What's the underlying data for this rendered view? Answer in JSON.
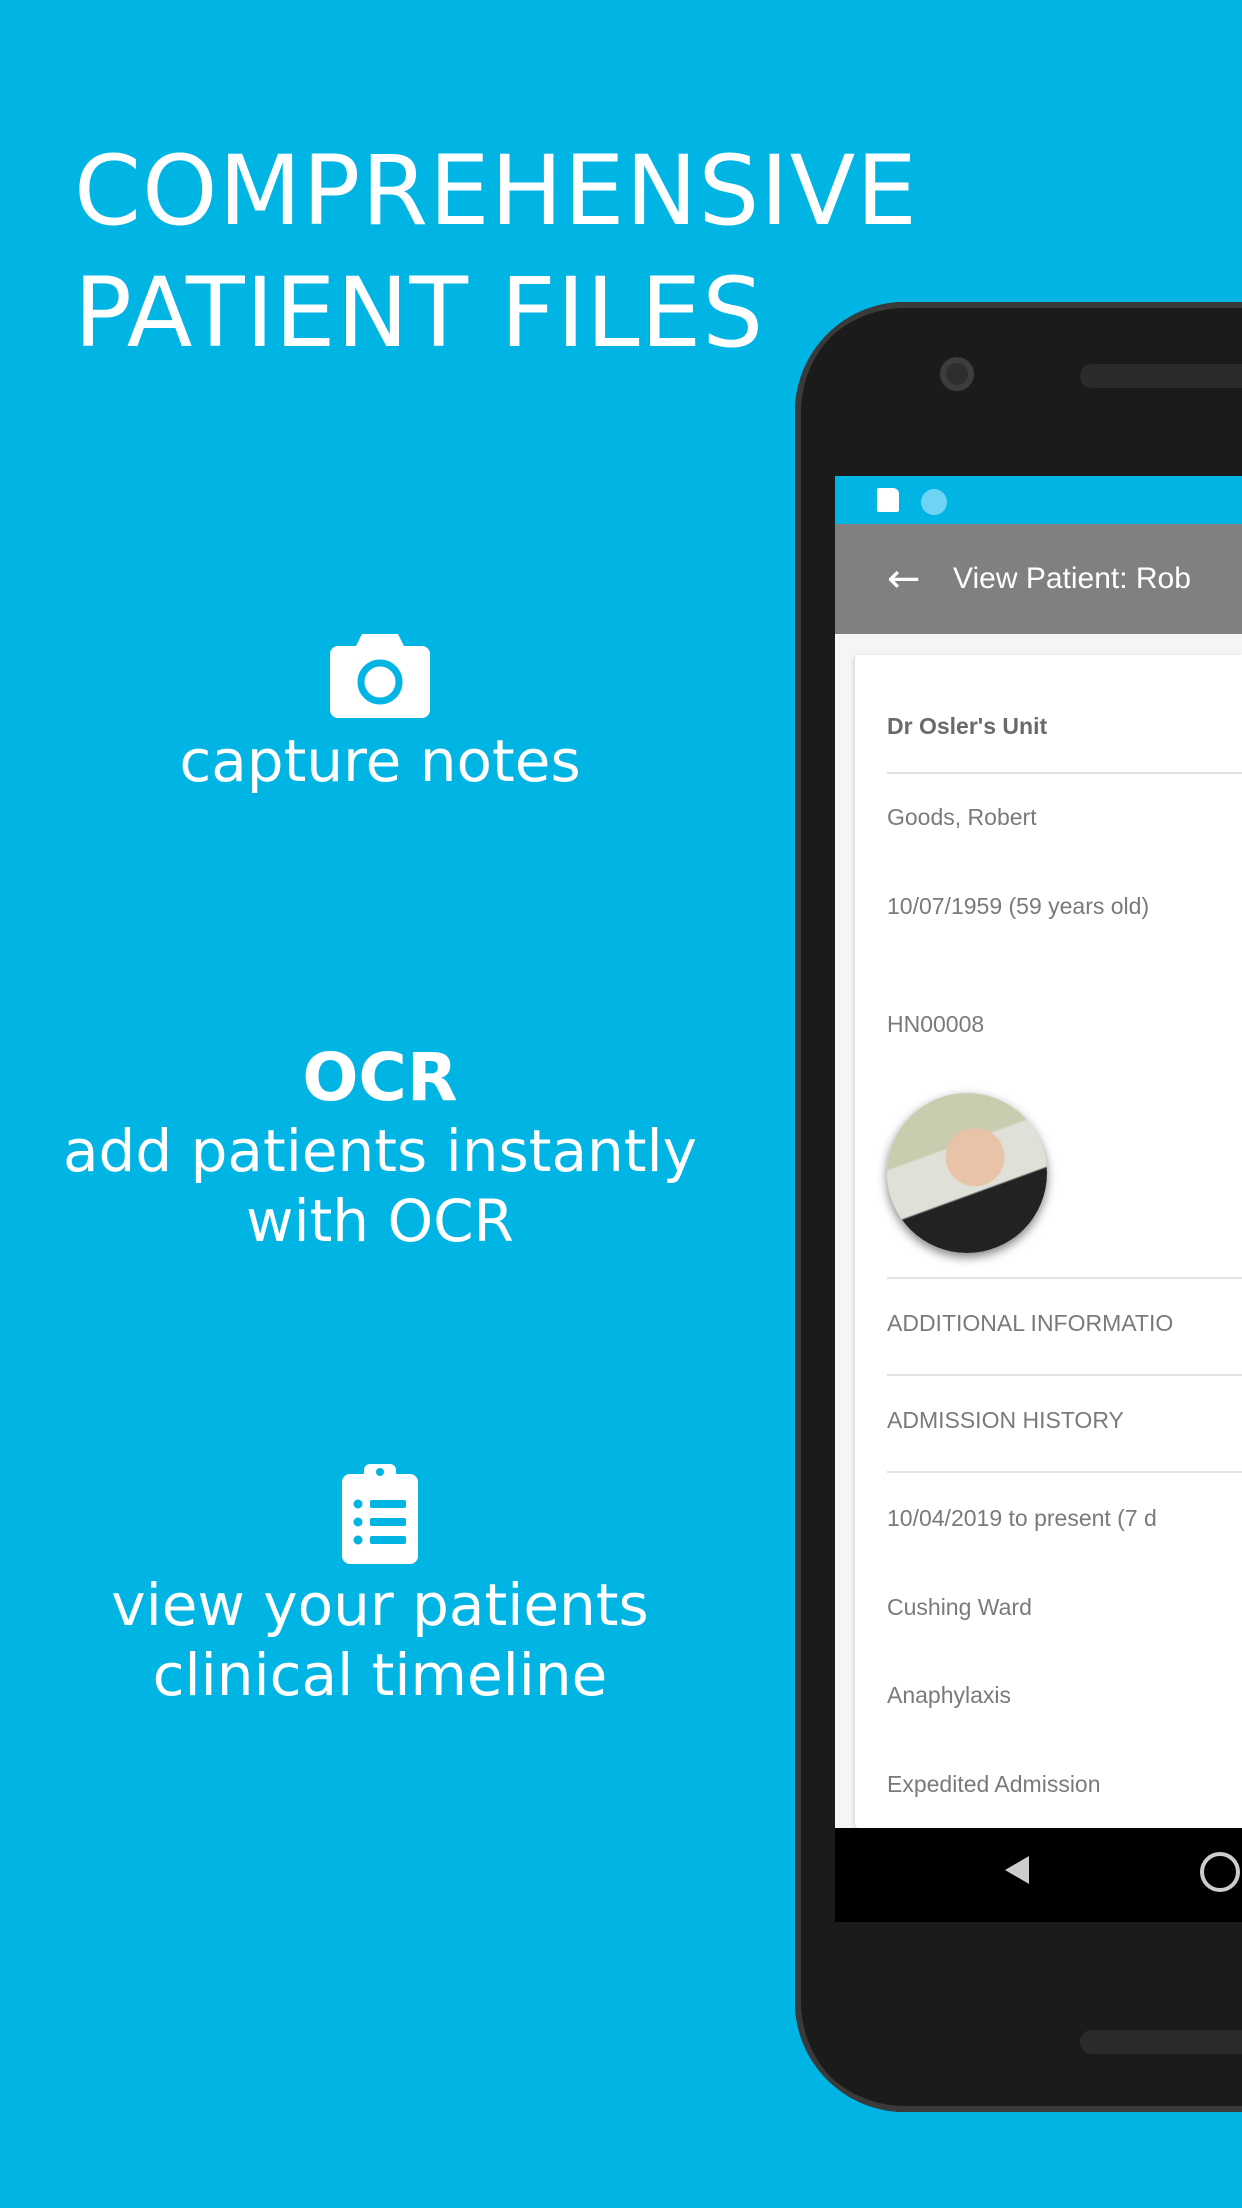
{
  "promo": {
    "headline_line1": "COMPREHENSIVE",
    "headline_line2": "PATIENT FILES",
    "features": [
      {
        "icon": "camera-icon",
        "title": "",
        "text_line1": "capture notes",
        "text_line2": ""
      },
      {
        "icon": "",
        "title": "OCR",
        "text_line1": "add patients instantly",
        "text_line2": "with OCR"
      },
      {
        "icon": "clipboard-list-icon",
        "title": "",
        "text_line1": "view your patients",
        "text_line2": "clinical timeline"
      }
    ],
    "background_color": "#00b4e4"
  },
  "app": {
    "title": "View Patient: Rob",
    "unit": "Dr Osler's Unit",
    "patient_name": "Goods, Robert",
    "dob": "10/07/1959 (59 years old)",
    "hospital_number": "HN00008",
    "sections": [
      "ADDITIONAL INFORMATIO",
      "ADMISSION HISTORY"
    ],
    "admission": {
      "dates": "10/04/2019 to present (7 d",
      "ward": "Cushing Ward",
      "diagnosis": "Anaphylaxis",
      "type": "Expedited Admission"
    },
    "appbar_color": "#808080"
  }
}
